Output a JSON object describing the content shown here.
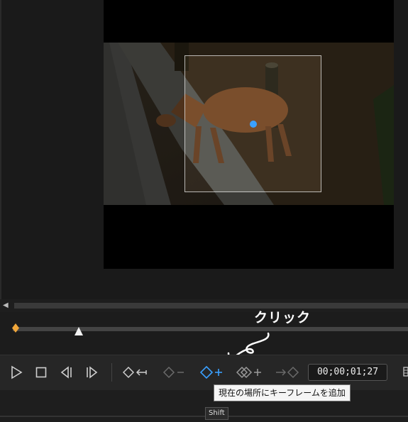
{
  "preview": {
    "video_description": "deer"
  },
  "annotation": {
    "text": "クリック"
  },
  "toolbar": {
    "play_icon": "play-icon",
    "stop_icon": "stop-icon",
    "prev_frame_icon": "previous-frame-icon",
    "next_frame_icon": "next-frame-icon",
    "goto_prev_keyframe_icon": "go-to-previous-keyframe-icon",
    "remove_keyframe_icon": "remove-keyframe-icon",
    "add_keyframe_icon": "add-keyframe-icon",
    "duplicate_keyframe_icon": "duplicate-keyframe-icon",
    "goto_next_keyframe_icon": "go-to-next-keyframe-icon",
    "timecode": "00;00;01;27"
  },
  "tooltip": {
    "text": "現在の場所にキーフレームを追加"
  },
  "shortcut": {
    "text": "Shift"
  },
  "colors": {
    "accent_blue": "#3aa0ff",
    "keyframe_orange": "#f0a63a",
    "icon_gray": "#cfcfcf",
    "disabled_gray": "#6a6a6a"
  }
}
